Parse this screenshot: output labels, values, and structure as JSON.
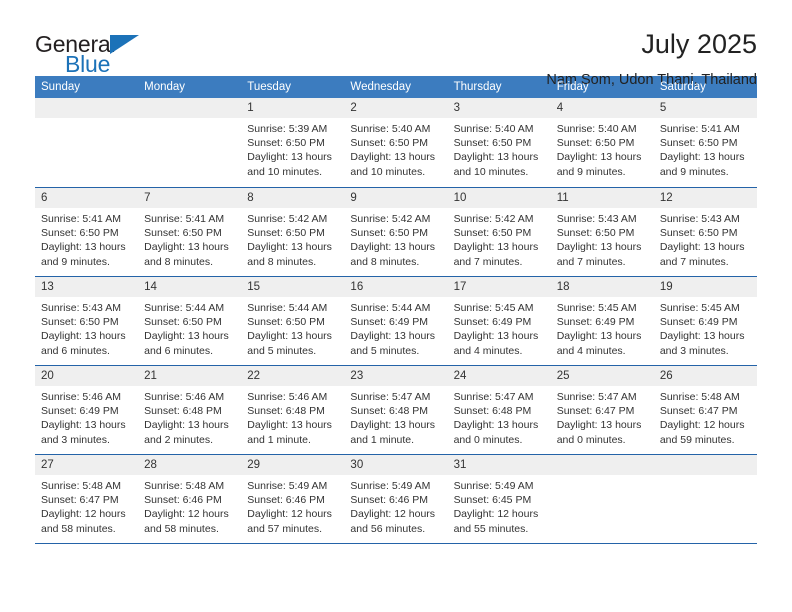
{
  "brand": {
    "name_part1": "General",
    "name_part2": "Blue",
    "accent_color": "#1c72b8"
  },
  "header": {
    "title": "July 2025",
    "subtitle": "Nam Som, Udon Thani, Thailand"
  },
  "calendar": {
    "header_bg": "#3c7cbf",
    "band_bg": "#efefef",
    "weekdays": [
      "Sunday",
      "Monday",
      "Tuesday",
      "Wednesday",
      "Thursday",
      "Friday",
      "Saturday"
    ],
    "weeks": [
      [
        {
          "day": "",
          "lines": []
        },
        {
          "day": "",
          "lines": []
        },
        {
          "day": "1",
          "lines": [
            "Sunrise: 5:39 AM",
            "Sunset: 6:50 PM",
            "Daylight: 13 hours",
            "and 10 minutes."
          ]
        },
        {
          "day": "2",
          "lines": [
            "Sunrise: 5:40 AM",
            "Sunset: 6:50 PM",
            "Daylight: 13 hours",
            "and 10 minutes."
          ]
        },
        {
          "day": "3",
          "lines": [
            "Sunrise: 5:40 AM",
            "Sunset: 6:50 PM",
            "Daylight: 13 hours",
            "and 10 minutes."
          ]
        },
        {
          "day": "4",
          "lines": [
            "Sunrise: 5:40 AM",
            "Sunset: 6:50 PM",
            "Daylight: 13 hours",
            "and 9 minutes."
          ]
        },
        {
          "day": "5",
          "lines": [
            "Sunrise: 5:41 AM",
            "Sunset: 6:50 PM",
            "Daylight: 13 hours",
            "and 9 minutes."
          ]
        }
      ],
      [
        {
          "day": "6",
          "lines": [
            "Sunrise: 5:41 AM",
            "Sunset: 6:50 PM",
            "Daylight: 13 hours",
            "and 9 minutes."
          ]
        },
        {
          "day": "7",
          "lines": [
            "Sunrise: 5:41 AM",
            "Sunset: 6:50 PM",
            "Daylight: 13 hours",
            "and 8 minutes."
          ]
        },
        {
          "day": "8",
          "lines": [
            "Sunrise: 5:42 AM",
            "Sunset: 6:50 PM",
            "Daylight: 13 hours",
            "and 8 minutes."
          ]
        },
        {
          "day": "9",
          "lines": [
            "Sunrise: 5:42 AM",
            "Sunset: 6:50 PM",
            "Daylight: 13 hours",
            "and 8 minutes."
          ]
        },
        {
          "day": "10",
          "lines": [
            "Sunrise: 5:42 AM",
            "Sunset: 6:50 PM",
            "Daylight: 13 hours",
            "and 7 minutes."
          ]
        },
        {
          "day": "11",
          "lines": [
            "Sunrise: 5:43 AM",
            "Sunset: 6:50 PM",
            "Daylight: 13 hours",
            "and 7 minutes."
          ]
        },
        {
          "day": "12",
          "lines": [
            "Sunrise: 5:43 AM",
            "Sunset: 6:50 PM",
            "Daylight: 13 hours",
            "and 7 minutes."
          ]
        }
      ],
      [
        {
          "day": "13",
          "lines": [
            "Sunrise: 5:43 AM",
            "Sunset: 6:50 PM",
            "Daylight: 13 hours",
            "and 6 minutes."
          ]
        },
        {
          "day": "14",
          "lines": [
            "Sunrise: 5:44 AM",
            "Sunset: 6:50 PM",
            "Daylight: 13 hours",
            "and 6 minutes."
          ]
        },
        {
          "day": "15",
          "lines": [
            "Sunrise: 5:44 AM",
            "Sunset: 6:50 PM",
            "Daylight: 13 hours",
            "and 5 minutes."
          ]
        },
        {
          "day": "16",
          "lines": [
            "Sunrise: 5:44 AM",
            "Sunset: 6:49 PM",
            "Daylight: 13 hours",
            "and 5 minutes."
          ]
        },
        {
          "day": "17",
          "lines": [
            "Sunrise: 5:45 AM",
            "Sunset: 6:49 PM",
            "Daylight: 13 hours",
            "and 4 minutes."
          ]
        },
        {
          "day": "18",
          "lines": [
            "Sunrise: 5:45 AM",
            "Sunset: 6:49 PM",
            "Daylight: 13 hours",
            "and 4 minutes."
          ]
        },
        {
          "day": "19",
          "lines": [
            "Sunrise: 5:45 AM",
            "Sunset: 6:49 PM",
            "Daylight: 13 hours",
            "and 3 minutes."
          ]
        }
      ],
      [
        {
          "day": "20",
          "lines": [
            "Sunrise: 5:46 AM",
            "Sunset: 6:49 PM",
            "Daylight: 13 hours",
            "and 3 minutes."
          ]
        },
        {
          "day": "21",
          "lines": [
            "Sunrise: 5:46 AM",
            "Sunset: 6:48 PM",
            "Daylight: 13 hours",
            "and 2 minutes."
          ]
        },
        {
          "day": "22",
          "lines": [
            "Sunrise: 5:46 AM",
            "Sunset: 6:48 PM",
            "Daylight: 13 hours",
            "and 1 minute."
          ]
        },
        {
          "day": "23",
          "lines": [
            "Sunrise: 5:47 AM",
            "Sunset: 6:48 PM",
            "Daylight: 13 hours",
            "and 1 minute."
          ]
        },
        {
          "day": "24",
          "lines": [
            "Sunrise: 5:47 AM",
            "Sunset: 6:48 PM",
            "Daylight: 13 hours",
            "and 0 minutes."
          ]
        },
        {
          "day": "25",
          "lines": [
            "Sunrise: 5:47 AM",
            "Sunset: 6:47 PM",
            "Daylight: 13 hours",
            "and 0 minutes."
          ]
        },
        {
          "day": "26",
          "lines": [
            "Sunrise: 5:48 AM",
            "Sunset: 6:47 PM",
            "Daylight: 12 hours",
            "and 59 minutes."
          ]
        }
      ],
      [
        {
          "day": "27",
          "lines": [
            "Sunrise: 5:48 AM",
            "Sunset: 6:47 PM",
            "Daylight: 12 hours",
            "and 58 minutes."
          ]
        },
        {
          "day": "28",
          "lines": [
            "Sunrise: 5:48 AM",
            "Sunset: 6:46 PM",
            "Daylight: 12 hours",
            "and 58 minutes."
          ]
        },
        {
          "day": "29",
          "lines": [
            "Sunrise: 5:49 AM",
            "Sunset: 6:46 PM",
            "Daylight: 12 hours",
            "and 57 minutes."
          ]
        },
        {
          "day": "30",
          "lines": [
            "Sunrise: 5:49 AM",
            "Sunset: 6:46 PM",
            "Daylight: 12 hours",
            "and 56 minutes."
          ]
        },
        {
          "day": "31",
          "lines": [
            "Sunrise: 5:49 AM",
            "Sunset: 6:45 PM",
            "Daylight: 12 hours",
            "and 55 minutes."
          ]
        },
        {
          "day": "",
          "lines": []
        },
        {
          "day": "",
          "lines": []
        }
      ]
    ]
  }
}
